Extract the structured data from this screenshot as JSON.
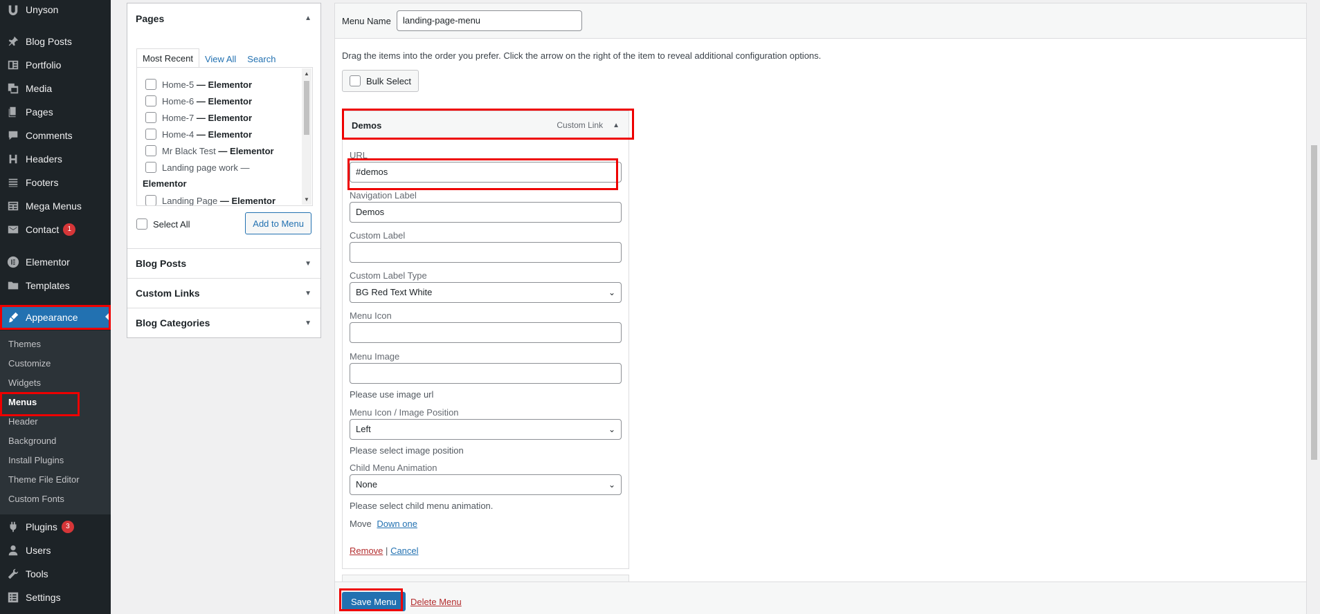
{
  "sidebar": {
    "brand": "Unyson",
    "items": [
      {
        "label": "Blog Posts",
        "icon": "pin-icon"
      },
      {
        "label": "Portfolio",
        "icon": "portfolio-icon"
      },
      {
        "label": "Media",
        "icon": "media-icon"
      },
      {
        "label": "Pages",
        "icon": "pages-icon"
      },
      {
        "label": "Comments",
        "icon": "comments-icon"
      },
      {
        "label": "Headers",
        "icon": "headers-icon"
      },
      {
        "label": "Footers",
        "icon": "footers-icon"
      },
      {
        "label": "Mega Menus",
        "icon": "mega-menu-icon"
      },
      {
        "label": "Contact",
        "icon": "mail-icon",
        "badge": "1"
      },
      {
        "label": "Elementor",
        "icon": "elementor-icon"
      },
      {
        "label": "Templates",
        "icon": "folder-icon"
      },
      {
        "label": "Appearance",
        "icon": "brush-icon"
      },
      {
        "label": "Plugins",
        "icon": "plugin-icon",
        "badge": "3"
      },
      {
        "label": "Users",
        "icon": "user-icon"
      },
      {
        "label": "Tools",
        "icon": "wrench-icon"
      },
      {
        "label": "Settings",
        "icon": "settings-icon"
      }
    ],
    "submenu": [
      "Themes",
      "Customize",
      "Widgets",
      "Menus",
      "Header",
      "Background",
      "Install Plugins",
      "Theme File Editor",
      "Custom Fonts"
    ]
  },
  "accordion": {
    "pages_title": "Pages",
    "tabs": [
      "Most Recent",
      "View All",
      "Search"
    ],
    "pages": [
      {
        "name": "Home-5",
        "builder": "— Elementor"
      },
      {
        "name": "Home-6",
        "builder": "— Elementor"
      },
      {
        "name": "Home-7",
        "builder": "— Elementor"
      },
      {
        "name": "Home-4",
        "builder": "— Elementor"
      },
      {
        "name": "Mr Black Test",
        "builder": "— Elementor"
      },
      {
        "name": "Landing page work —",
        "builder": ""
      },
      {
        "name": "",
        "builder": "Elementor"
      },
      {
        "name": "Landing Page",
        "builder": "— Elementor"
      }
    ],
    "select_all": "Select All",
    "add_to_menu": "Add to Menu",
    "sections": [
      "Blog Posts",
      "Custom Links",
      "Blog Categories"
    ]
  },
  "editor": {
    "menu_name_label": "Menu Name",
    "menu_name_value": "landing-page-menu",
    "instructions": "Drag the items into the order you prefer. Click the arrow on the right of the item to reveal additional configuration options.",
    "bulk_select": "Bulk Select",
    "item": {
      "title": "Demos",
      "type": "Custom Link",
      "url_label": "URL",
      "url_value": "#demos",
      "nav_label": "Navigation Label",
      "nav_value": "Demos",
      "custom_label": "Custom Label",
      "custom_label_value": "",
      "custom_label_type": "Custom Label Type",
      "custom_label_type_value": "BG Red Text White",
      "menu_icon": "Menu Icon",
      "menu_icon_value": "",
      "menu_image": "Menu Image",
      "menu_image_value": "",
      "menu_image_help": "Please use image url",
      "position_label": "Menu Icon / Image Position",
      "position_value": "Left",
      "position_help": "Please select image position",
      "animation_label": "Child Menu Animation",
      "animation_value": "None",
      "animation_help": "Please select child menu animation.",
      "move_label": "Move",
      "move_link": "Down one",
      "remove": "Remove",
      "separator": "|",
      "cancel": "Cancel"
    },
    "save_menu": "Save Menu",
    "delete_menu": "Delete Menu"
  },
  "colors": {
    "highlight": "#ee0000",
    "accent": "#2271b1",
    "sidebar": "#1d2327"
  }
}
